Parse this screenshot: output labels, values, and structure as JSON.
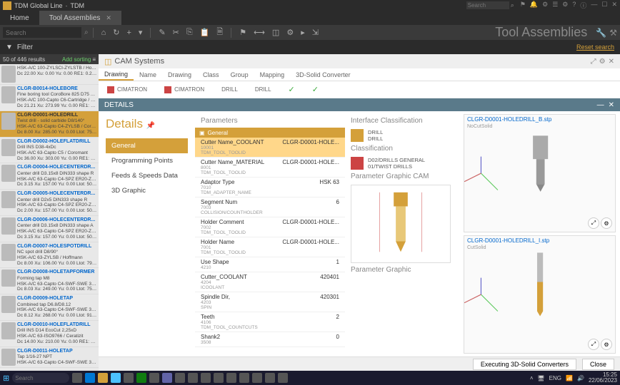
{
  "titlebar": {
    "app_name": "TDM Global Line",
    "module": "TDM",
    "search_placeholder": "Search"
  },
  "tabs": {
    "home": "Home",
    "tool_assemblies": "Tool Assemblies"
  },
  "toolbar": {
    "search_placeholder": "Search",
    "title": "Tool Assemblies"
  },
  "filter": {
    "label": "Filter",
    "reset": "Reset search"
  },
  "results": {
    "count_text": "50 of 446 results",
    "add_sorting": "Add sorting",
    "items": [
      {
        "name": "",
        "desc": "HSK-A/C 100-ZYLSCI-ZYLSTB / Hoffm...",
        "dim": "Dc 22.00 Xu: 0.00 Yu: 0.00 RE1: 0.2 Ltot:"
      },
      {
        "name": "CLGR-B0014-HOLEBORE",
        "desc": "Fine boring tool CoroBore 825 D75 Kap...",
        "spec": "HSK-A/C 100-Capto C6-Cartridge / Co...",
        "dim": "Dc 21.21 Xu: 273.99 Yu: 0.00 RE1: 0.8 Ltot:"
      },
      {
        "name": "CLGR-D0001-HOLEDRILL",
        "desc": "Twist drill - solid carbide D8/140°",
        "spec": "HSK-A/C 63-Capto C4-ZYLSB / Coro...",
        "dim": "Dc 8.00 Xu: 285.00 Yu: 0.00 Ltot: 75.00 Cov"
      },
      {
        "name": "CLGR-D0002-HOLEFLATDRILL",
        "desc": "Drill INS D38-4xDc",
        "spec": "HSK-A/C 63-Capto C5 / Coromant",
        "dim": "Dc 36.00 Xu: 303.00 Yu: 0.00 RE1: 0.0 Ltot:"
      },
      {
        "name": "CLGR-D0004-HOLECENTERDR...",
        "desc": "Center drill D3.15x8 DIN333 shape R",
        "spec": "HSK-A/C 63-Capto C4-SPZ ER20-ZYLBB /...",
        "dim": "Dc 3.15 Xu: 157.00 Yu: 0.00 Ltot: 50.00 Cov"
      },
      {
        "name": "CLGR-D0005-HOLECENTERDR...",
        "desc": "Center drill D2x5 DIN333 shape R",
        "spec": "HSK-A/C 63-Capto C4-SPZ ER20-ZYLB...",
        "dim": "Dc 2.00 Xu: 157.00 Yu: 0.00 Ltot: 50.00 Cov"
      },
      {
        "name": "CLGR-D0006-HOLECENTERDR...",
        "desc": "Center drill D3.15x8 DIN333 shape A",
        "spec": "HSK-A/C 63-Capto C4-SPZ ER20-ZYLB...",
        "dim": "Dc 3.15 Xu: 157.00 Yu: 0.00 Ltot: 50.00 Cov"
      },
      {
        "name": "CLGR-D0007-HOLESPOTDRILL",
        "desc": "NC spot drill D8/90°",
        "spec": "HSK-A/C 63-ZYLSB / Hoffmann",
        "dim": "Dc 8.00 Xu: 106.00 Yu: 0.00 Ltot: 79.00 Cov"
      },
      {
        "name": "CLGR-D0008-HOLETAPFORMER",
        "desc": "Forming tap M8",
        "spec": "HSK-A/C 63-Capto C4-SWF-SWE 31-G...",
        "dim": "Dc 8.03 Xu: 249.00 Yu: 0.00 Ltot: 75.89 Cov"
      },
      {
        "name": "CLGR-D0009-HOLETAP",
        "desc": "Combined tap D6.8/D8.12",
        "spec": "HSK-A/C 63-Capto C4-SWF-SWE 31-G...",
        "dim": "Dc 8.12 Xu: 268.00 Yu: 0.00 Ltot: 91.96 Cov"
      },
      {
        "name": "CLGR-D0010-HOLEFLATDRILL",
        "desc": "Drill INS D14 EcoCut 2,25xD",
        "spec": "HSK-A/C 63-ISO9766 / Ceratizit",
        "dim": "Dc 14.00 Xu: 210.00 Yu: 0.00 RE1: 0.4 Ltot: 6"
      },
      {
        "name": "CLGR-D0011-HOLETAP",
        "desc": "Tap 1/16-27 NPT",
        "spec": "HSK-A/C 63-Capto C4-SWF-SWE 31-G...",
        "dim": ""
      }
    ]
  },
  "cam": {
    "title": "CAM Systems",
    "sub_tabs": [
      "Drawing",
      "Name",
      "Drawing",
      "Class",
      "Group",
      "Mapping",
      "3D-Solid Converter"
    ],
    "types": [
      "CIMATRON",
      "CIMATRON",
      "DRILL",
      "DRILL"
    ]
  },
  "details": {
    "bar_title": "DETAILS",
    "title": "Details",
    "nav": [
      "General",
      "Programming Points",
      "Feeds & Speeds Data",
      "3D Graphic"
    ],
    "params_title": "Parameters",
    "group_label": "General",
    "params": [
      {
        "name": "Cutter Name_COOLANT",
        "sub": "10001",
        "sub2": "TDM_TOOL_TOOLID",
        "val": "CLGR-D0001-HOLE...",
        "sel": true
      },
      {
        "name": "Cutter Name_MATERIAL",
        "sub": "8001",
        "sub2": "TDM_TOOL_TOOLID",
        "val": "CLGR-D0001-HOLE..."
      },
      {
        "name": "Adaptor Type",
        "sub": "7010",
        "sub2": "TDM_ADAPTER_NAME",
        "val": "HSK 63"
      },
      {
        "name": "Segment Num",
        "sub": "7003",
        "sub2": "COLLISION/COUNTHOLDER",
        "val": "6"
      },
      {
        "name": "Holder Comment",
        "sub": "7002",
        "sub2": "TDM_TOOL_TOOLID",
        "val": "CLGR-D0001-HOLE..."
      },
      {
        "name": "Holder Name",
        "sub": "7001",
        "sub2": "TDM_TOOL_TOOLID",
        "val": "CLGR-D0001-HOLE..."
      },
      {
        "name": "Use Shape",
        "sub": "4210",
        "sub2": "",
        "val": "1"
      },
      {
        "name": "Cutter_COOLANT",
        "sub": "4204",
        "sub2": "ICOOLANT",
        "val": "420401"
      },
      {
        "name": "Spindle Dir,",
        "sub": "4203",
        "sub2": "SPIN",
        "val": "420301"
      },
      {
        "name": "Teeth",
        "sub": "4106",
        "sub2": "TDM_TOOL_COUNTCUTS",
        "val": "2"
      },
      {
        "name": "Shank2",
        "sub": "3508",
        "sub2": "",
        "val": "0"
      }
    ],
    "interface_title": "Interface Classification",
    "interface_items": [
      "DRILL",
      "DRILL"
    ],
    "classification_title": "Classification",
    "classification_text": "D02/DRILLS GENERAL\n01/TWIST DRILLS",
    "param_graphic_cam": "Parameter Graphic CAM",
    "param_graphic": "Parameter Graphic",
    "views": [
      {
        "title": "CLGR-D0001-HOLEDRILL_B.stp",
        "sub": "NoCutSolid"
      },
      {
        "title": "CLGR-D0001-HOLEDRILL_I.stp",
        "sub": "CutSolid"
      }
    ]
  },
  "footer": {
    "executing": "Executing 3D-Solid Converters",
    "close": "Close"
  },
  "taskbar": {
    "search": "Search",
    "lang": "ENG",
    "time": "15:25",
    "date": "22/06/2023"
  }
}
